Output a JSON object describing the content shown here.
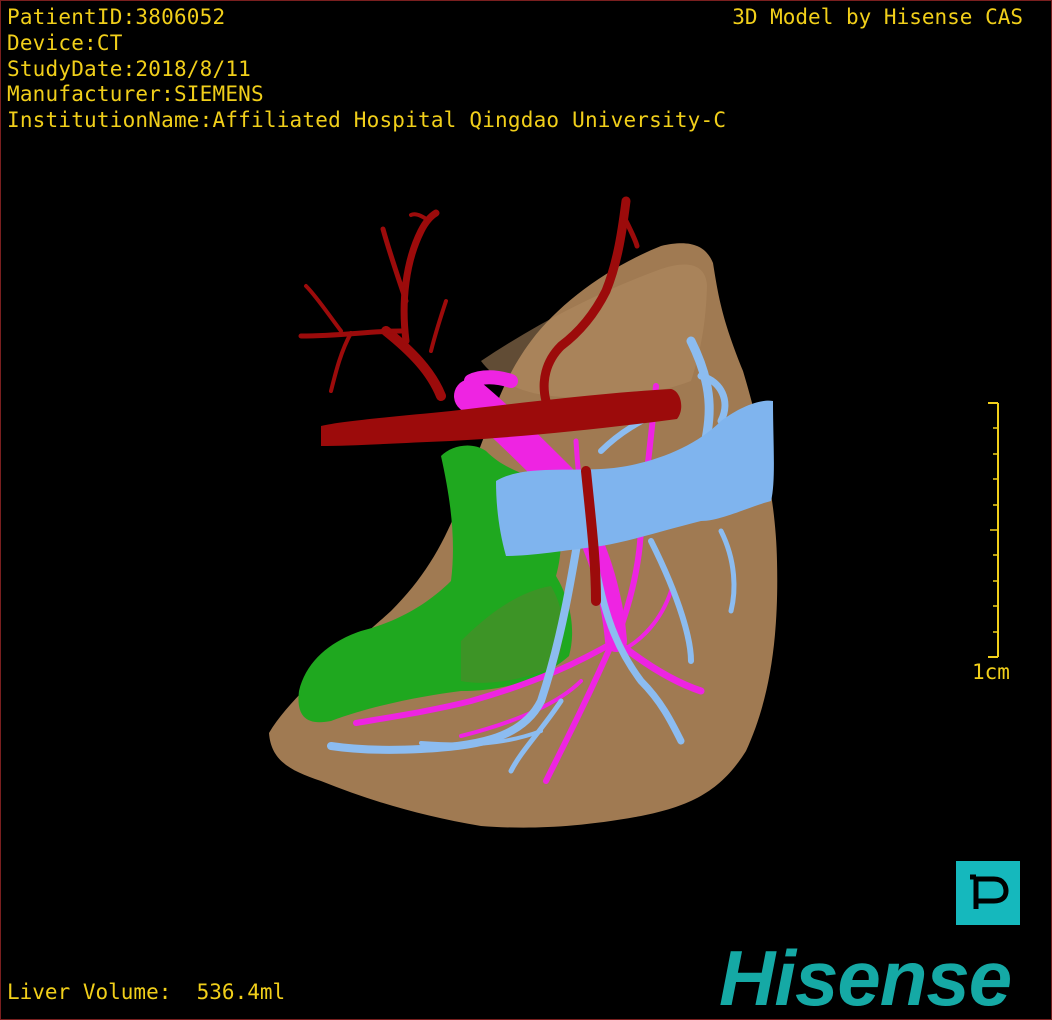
{
  "patient_info": {
    "lines": [
      "PatientID:3806052",
      "Device:CT",
      "StudyDate:2018/8/11",
      "Manufacturer:SIEMENS",
      "InstitutionName:Affiliated Hospital Qingdao University-C"
    ]
  },
  "header": {
    "credit": "3D Model by Hisense CAS"
  },
  "footer": {
    "volume": "Liver Volume:  536.4ml"
  },
  "scale": {
    "label": "1cm"
  },
  "brand": {
    "logo_text": "Hisense",
    "button_icon": "parking-p-icon"
  },
  "model": {
    "structures": [
      {
        "name": "liver",
        "color": "#a07a52"
      },
      {
        "name": "artery",
        "color": "#9c0b0b"
      },
      {
        "name": "portal-vein",
        "color": "#ee24e2"
      },
      {
        "name": "hepatic-vein",
        "color": "#7fb4ee"
      },
      {
        "name": "lesion",
        "color": "#1fa81f"
      }
    ]
  },
  "colors": {
    "text": "#f1cf1a",
    "accent": "#15b8bd",
    "border": "#7a1f1f"
  }
}
